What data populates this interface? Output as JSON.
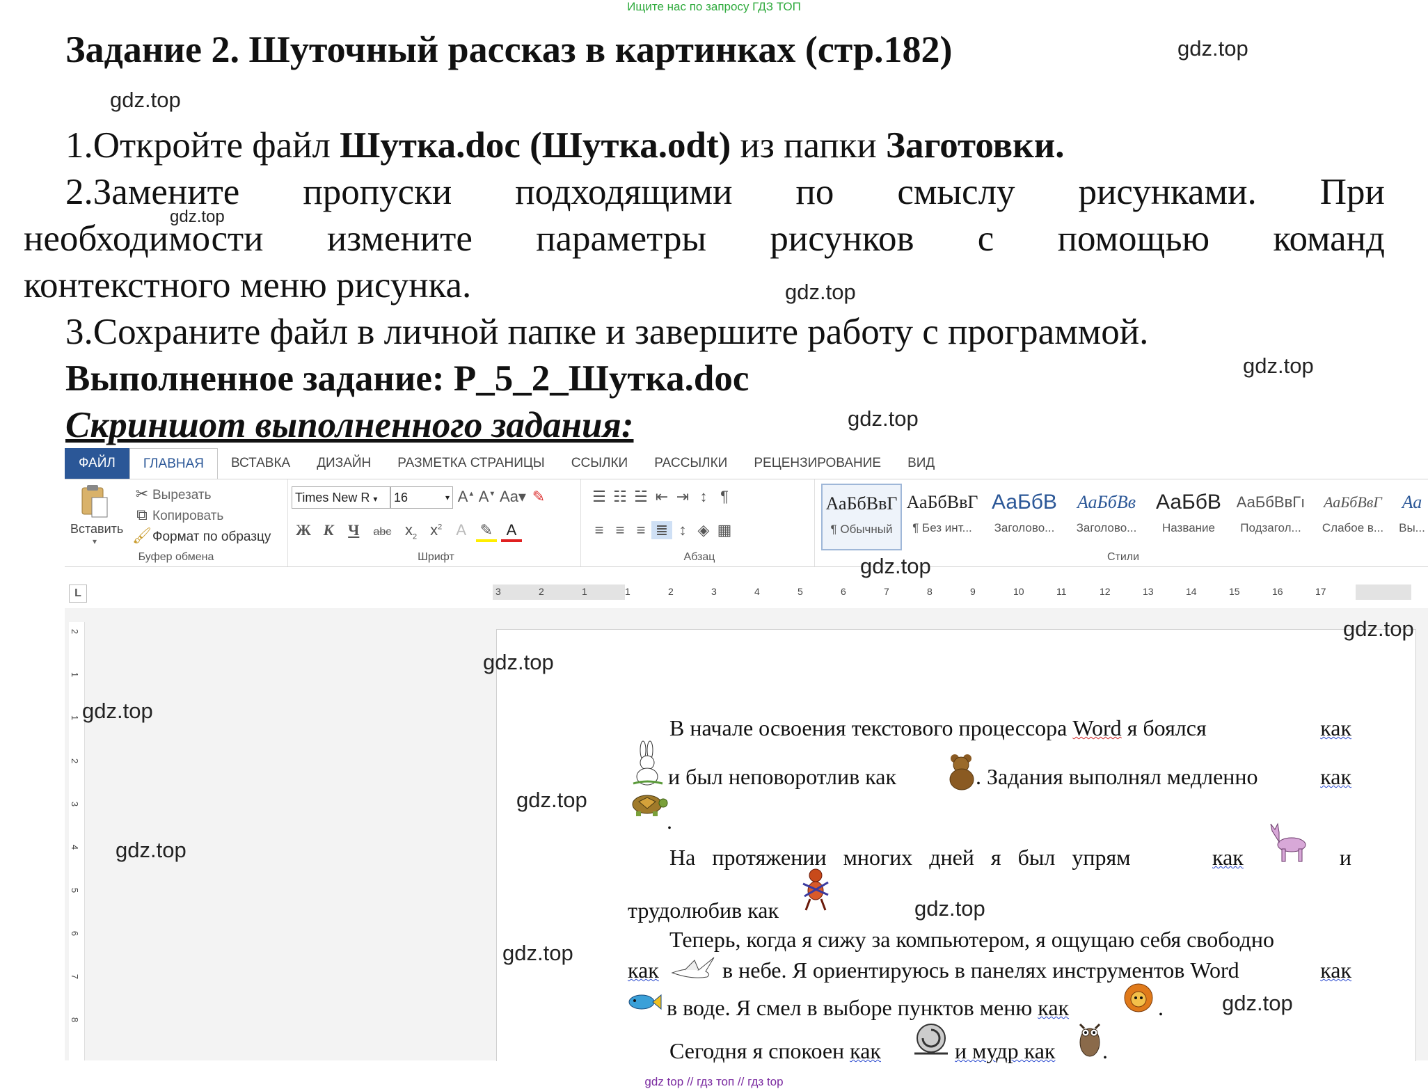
{
  "header_note": "Ищите нас по запросу ГДЗ ТОП",
  "title": "Задание 2. Шуточный рассказ в картинках (стр.182)",
  "watermark": "gdz.top",
  "steps": {
    "s1_a": "1.Откройте файл ",
    "s1_b": "Шутка.doc (Шутка.odt)",
    "s1_c": " из папки ",
    "s1_d": "Заготовки.",
    "s2_words": [
      "2.Замените",
      "пропуски",
      "подходящими",
      "по",
      "смыслу",
      "рисунками.",
      "При"
    ],
    "s2_line2": [
      "необходимости",
      "измените",
      "параметры",
      "рисунков",
      "с",
      "помощью",
      "команд"
    ],
    "s2_line3": "контекстного меню рисунка.",
    "s3": "3.Сохраните файл в личной папке и завершите работу с программой."
  },
  "done_label": "Выполненное задание: Р_5_2_Шутка.doc",
  "screenshot_label": "Скриншот выполненного задания:",
  "ribbon": {
    "tabs": [
      "ФАЙЛ",
      "ГЛАВНАЯ",
      "ВСТАВКА",
      "ДИЗАЙН",
      "РАЗМЕТКА СТРАНИЦЫ",
      "ССЫЛКИ",
      "РАССЫЛКИ",
      "РЕЦЕНЗИРОВАНИЕ",
      "ВИД"
    ],
    "clipboard": {
      "paste": "Вставить",
      "cut": "Вырезать",
      "copy": "Копировать",
      "format_painter": "Формат по образцу",
      "group": "Буфер обмена"
    },
    "font": {
      "font_name": "Times New R",
      "font_size": "16",
      "group": "Шрифт",
      "bold": "Ж",
      "italic": "К",
      "underline": "Ч",
      "strike": "abc"
    },
    "paragraph": {
      "group": "Абзац"
    },
    "styles": {
      "group": "Стили",
      "items": [
        {
          "preview": "АаБбВвГ",
          "name": "¶ Обычный"
        },
        {
          "preview": "АаБбВвГ",
          "name": "¶ Без инт..."
        },
        {
          "preview": "АаБбВ",
          "name": "Заголово..."
        },
        {
          "preview": "АаБбВв",
          "name": "Заголово..."
        },
        {
          "preview": "АаБбВ",
          "name": "Название"
        },
        {
          "preview": "АаБбВвГı",
          "name": "Подзагол..."
        },
        {
          "preview": "АаБбВвГ",
          "name": "Слабое в..."
        },
        {
          "preview": "Аа",
          "name": "Вы..."
        }
      ]
    }
  },
  "ruler": {
    "h_labels": [
      "3",
      "2",
      "1",
      "1",
      "2",
      "3",
      "4",
      "5",
      "6",
      "7",
      "8",
      "9",
      "10",
      "11",
      "12",
      "13",
      "14",
      "15",
      "16",
      "17"
    ],
    "v_labels": [
      "2",
      "1",
      "1",
      "2",
      "3",
      "4",
      "5",
      "6",
      "7",
      "8"
    ],
    "corner": "L"
  },
  "document": {
    "p1_l1_a": "В начале освоения текстового процессора ",
    "p1_l1_word": "Word",
    "p1_l1_b": " я боялся ",
    "p1_l1_kak": "как",
    "p1_l2_a": "и был неповоротлив как",
    "p1_l2_b": ". Задания выполнял медленно ",
    "p1_l2_kak": "как",
    "p1_l3": ".",
    "p2_l1_a": "На протяжении многих дней я был упрям ",
    "p2_l1_kak": "как",
    "p2_l1_i": "и",
    "p2_l2": "трудолюбив как",
    "p3_l1": "Теперь, когда я сижу за компьютером, я ощущаю себя свободно",
    "p3_l2_kak": "как",
    "p3_l2_a": " в небе. Я ориентируюсь в панелях инструментов Word ",
    "p3_l2_kak2": "как",
    "p3_l3_a": "в воде. Я смел в выборе пунктов меню ",
    "p3_l3_kak": "как",
    "p3_l3_dot": ".",
    "p4_a": "Сегодня я спокоен ",
    "p4_kak": "как",
    "p4_b": "и мудр как",
    "p4_dot": "."
  },
  "footer_note": "gdz top  //  гдз топ  //  гдз top"
}
